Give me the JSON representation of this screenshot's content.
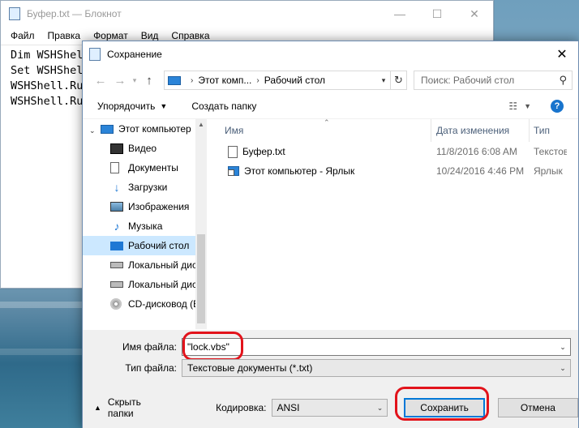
{
  "notepad": {
    "title": "Буфер.txt — Блокнот",
    "controls": {
      "minimize": "—",
      "maximize": "☐",
      "close": "✕"
    },
    "menu": [
      "Файл",
      "Правка",
      "Формат",
      "Вид",
      "Справка"
    ],
    "lines": [
      "Dim WSHShel",
      "Set WSHShel",
      "WSHShell.Ru",
      "WSHShell.Ru"
    ]
  },
  "dialog": {
    "title": "Сохранение",
    "close": "✕",
    "address": {
      "part1": "Этот комп...",
      "part2": "Рабочий стол"
    },
    "search": {
      "placeholder": "Поиск: Рабочий стол"
    },
    "toolbar": {
      "organize": "Упорядочить",
      "new_folder": "Создать папку",
      "help": "?"
    },
    "nav": {
      "root": "Этот компьютер",
      "items": [
        "Видео",
        "Документы",
        "Загрузки",
        "Изображения",
        "Музыка",
        "Рабочий стол",
        "Локальный дис",
        "Локальный дис",
        "CD-дисковод (E"
      ],
      "selected_index": 5
    },
    "columns": {
      "name": "Имя",
      "date": "Дата изменения",
      "type": "Тип"
    },
    "files": [
      {
        "name": "Буфер.txt",
        "date": "11/8/2016 6:08 AM",
        "type": "Текстовы"
      },
      {
        "name": "Этот компьютер - Ярлык",
        "date": "10/24/2016 4:46 PM",
        "type": "Ярлык"
      }
    ],
    "filename": {
      "label": "Имя файла:",
      "value": "\"lock.vbs\""
    },
    "filetype": {
      "label": "Тип файла:",
      "value": "Текстовые документы (*.txt)"
    },
    "hide_folders": "Скрыть папки",
    "encoding": {
      "label": "Кодировка:",
      "value": "ANSI"
    },
    "save_button": "Сохранить",
    "cancel_button": "Отмена",
    "highlight_color": "#e2131b",
    "accent_color": "#0078d7"
  }
}
